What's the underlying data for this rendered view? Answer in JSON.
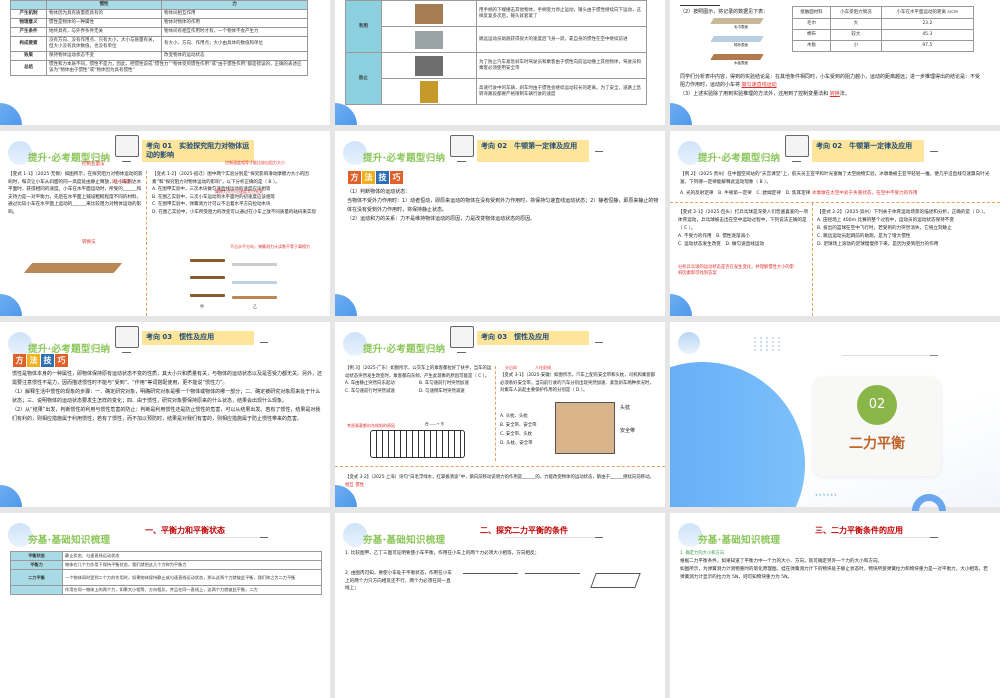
{
  "slides": [
    {
      "table": {
        "headers": [
          "惯性",
          "力"
        ],
        "rows": [
          [
            "产生机制",
            "物体因为具有质量而具有的",
            "物体间相互作用"
          ],
          [
            "物理意义",
            "惯性是物体的一种属性",
            "物体对物体的作用"
          ],
          [
            "产生条件",
            "始终具有，与外界条件无关",
            "物体间有相互作用时才有，一个物体不会产生力"
          ],
          [
            "构成要素",
            "没有方向、没有作用点、只有大小，大小与质量有关，但大小没有具体数值，也没有单位",
            "有大小、方向、作用点；大小由具体的数值和单位"
          ],
          [
            "效果",
            "保持物体运动状态不变",
            "改变物体的运动状态"
          ],
          [
            "总结",
            "惯性和力本质不同，惯性不是力，因此，把惯性说成“惯性力”“物体受到惯性作用”或“由于惯性作用”都是错误的，正确的表述应该为“物体由于惯性”或“物体因为具有惯性”",
            ""
          ]
        ]
      }
    },
    {
      "groups": [
        {
          "label": "利用",
          "items": [
            "用手柄的下端撞击其他物体，手柄受力停止运动，锤头由于惯性继续向下运动，这样反复多次后，锤头就套紧了",
            "跳远运动员助跑获得很大的速度后飞身一跃，靠自身的惯性在空中继续前进"
          ]
        },
        {
          "label": "防止",
          "items": [
            "为了防止汽车紧急刹车时驾驶员和乘客由于惯性向前运动撞上其他物体，驾驶员和乘客必须使用安全带",
            "高速行驶中的车辆，刹车时由于惯性会继续运动较长的距离。为了安全，道路上急转弯路段都要严格限制车辆行驶的速度"
          ]
        }
      ]
    },
    {
      "q2": "（2）按照图示，将记录的数据见下表：",
      "table_headers": [
        "接触面材料",
        "小车受阻力情况",
        "小车在水平面运动的距离 s/cm"
      ],
      "rows": [
        [
          "毛巾",
          "大",
          "23.2"
        ],
        [
          "棉布",
          "较大",
          "45.3"
        ],
        [
          "木板",
          "小",
          "97.5"
        ]
      ],
      "surfaces": [
        "毛巾表面",
        "棉布表面",
        "木板表面"
      ],
      "marks": [
        "甲",
        "乙",
        "丙"
      ],
      "conclusion": "同学们分析表中内容，得到的实验结论是：在其他条件相同时，小车受到的阻力越小，运动的距离越远；进一步推理得出的结论是：不受阻力作用时，运动的小车将",
      "answer1": "做匀速直线运动",
      "q3": "（3）上述实验除了用到实验推理的方法外，还用到了控制变量法和",
      "answer2": "转换",
      "q3_end": "法。"
    },
    {
      "header": "提升·必考题型归纳",
      "topic": "考向 01　实验探究阻力对物体运动的影响",
      "ann1": "控制变量法",
      "ann2": "控制速度相等才能比较出阻力大小",
      "left": "【变式 1-1】（2025·无锡）如图所示，在探究阻力对物体运动的影响时，每次让小车从斜面的同一高度处由静止释放，让小车到达水平面时，获得相同的速度。小车在水平面运动时，所受的______和支持力是一对平衡力，先后在水平面上铺设粗糙程度不同的材料，通过比较小车在水平面上运动的______来比较阻力对物体运动的影响。",
      "left_ann": [
        "同一高度",
        "重力",
        "距离",
        "转换法"
      ],
      "right": [
        "【变式 1-2】（2025·宿迁）图中两个实验分别是“探究影响滑动摩擦力大小的因素”和“探究阻力对物体运动的影响”，以下分析正确的是（ B ）。",
        "A. 在图甲实验中，三次木块做匀速直线运动的速度应该相等",
        "B. 在图乙实验中，三次小车运动到水平面时的初速度应该相等",
        "C. 在图甲实验中，弹簧测力计可以不沿着水平方向拉动木块",
        "D. 在图乙实验中，小车所受阻力的改变可以通过在小车上放不同质量的砝码来实现"
      ],
      "right_ann": [
        "摩擦力大小与速度大小无关",
        "分清实验目的是什么?",
        "不沿水平方向，弹簧测力计读数不等于摩擦力"
      ],
      "fig_labels": [
        "木板",
        "砝码",
        "木板",
        "砝码",
        "棉布",
        "毛巾",
        "棉布",
        "木板",
        "甲",
        "乙"
      ]
    },
    {
      "header": "提升·必考题型归纳",
      "topic": "考向 02　牛顿第一定律及应用",
      "method": [
        "方",
        "法",
        "技",
        "巧"
      ],
      "lines": [
        "（1）判断物体的运动状态：",
        "当物体不受外力作用时：1）动者恒动，即原来运动的物体在没有受到外力作用时，将保持匀速直线运动状态；2）静者恒静，即原来静止的物体在没有受到外力作用时，将保持静止状态。",
        "（2）运动和力的关系：力不是维持物体运动的原因，力是改变物体运动状态的原因。"
      ]
    },
    {
      "header": "提升·必考题型归纳",
      "topic": "考向 02　牛顿第一定律及应用",
      "ex": "【例 2】（2025·贵州）在中国空间站的“天宫课堂”上，航天员王亚平和叶光富做了太空抛物实验，冰墩墩被王亚平轻轻一推，便几乎沿直线匀速飘向叶光富。下列哪一定律能解释此运动现象（ B ）。",
      "ex_opts": "A. 光的反射定律　B. 牛顿第一定律　C. 欧姆定律　D. 焦耳定律",
      "ex_ann": "冰墩墩在太空中处于失重状态，在空中不受力的作用",
      "left": [
        "【变式 2-1】（2025·包头）打乒乓球是深受人们普遍喜爱的一项体育运动，乒乓球被击出在空中运动过程中，下列说法正确的是（ C ）。",
        "A. 不受力的作用　B. 惯性逐渐减小",
        "C. 运动状态发生改变　D. 做匀速直线运动"
      ],
      "left_ann": "分析乒乓球的运动状态是否在发生变化，并理解惯性大小的影响因素即可找到答案",
      "right": [
        "【变式 2-2】（2025·滨州）下列关于体育运动场景的描述和分析，正确的是（ D ）。",
        "A. 田径场上 400m 比赛的整个过程中，运动员的运动状态保持不变",
        "B. 投出的篮球在空中飞行时，若受到的力突然消失，它将立刻静止",
        "C. 跳远运动员起跳前的助跑，是为了增大惯性",
        "D. 足球场上滚动的足球慢慢停下来，是因为受到阻力的作用"
      ]
    },
    {
      "header": "提升·必考题型归纳",
      "topic": "考向 03　惯性及应用",
      "method": [
        "方",
        "法",
        "技",
        "巧"
      ],
      "lines": [
        "惯性是物体本身的一种属性，即物体保持原有运动状态不变的性质，其大小只和质量有关，与物体的运动状态以及是否受力都无关。另外，还需要注意惯性不是力，因而描述惯性时不能与“受到”、“作用”等词搭配使用，更不能说“惯性力”。",
        "（1）解释生活中惯性的现象的步骤：一、确定研究对象，明确研究对象是哪一个物体或物体的哪一部分；二、确定被研究对象原来处于什么状态；三、说明物体的运动状态要发生怎样的变化；四、由于惯性，研究对象要保持原来的什么状态，结果会出现什么现象。",
        "（2）从“结果”出发，判断惯性的利用与惯性危害的防止：判断是利用惯性还是防止惯性的危害，可以从结果出发。若有了惯性，结果是对我们有利的，则相应措施属于利用惯性；若有了惯性，而不加以预防时，结果是对我们有害的，则相应措施属于防止惯性带来的危害。"
      ]
    },
    {
      "header": "提升·必考题型归纳",
      "topic": "考向 03　惯性及应用",
      "ex": "【例 3】（2025·广东）如图所示，公交车上的乘客都拉好了扶手，当车的运动状态突然发生改变时，乘客都向东倾，产生此现象的原因可能是（ C ）。",
      "ex_opts": [
        "A. 车由静止突然向东起动",
        "B. 车匀速前行时突然加速",
        "C. 车匀速前行时突然减速",
        "D. 匀速倒车时突然减速"
      ],
      "ex_ann": "考虑乘客都向东倾斜的原因",
      "dir": "西 ——→ 东",
      "v31": [
        "【变式 3-1】（2025·安徽）如图所示，汽车上配有安全带和头枕，司机和乘客都必须系好安全带。当向前行驶的汽车分别出现突然加速、紧急刹车两种状况时，对乘车人员起主要保护作用的分别是（ D ）。",
        "A. 头枕、头枕",
        "B. 安全带、安全带",
        "C. 安全带、头枕",
        "D. 头枕、安全带"
      ],
      "v31_ann": [
        "头后仰",
        "人往前倾"
      ],
      "car_labels": [
        "头枕",
        "安全带"
      ],
      "v32": "【变式 3-2】（2025·上海）诗句“白毛浮绿水，红掌拨清波”中，鹅向前移动说明力的作用是______的，力能改变物体的运动状态，鹅由于______继续向前移动。",
      "v32_ans": [
        "相互",
        "惯性"
      ]
    },
    {
      "number": "02",
      "title": "二力平衡"
    },
    {
      "header": "夯基·基础知识梳理",
      "heading": "一、平衡力和平衡状态",
      "rows": [
        [
          "平衡状态",
          "静止状态、匀速直线运动状态"
        ],
        [
          "平衡力",
          "物体在几个力作用下保持平衡状态，我们就把这几个力称为平衡力"
        ],
        [
          "二力平衡",
          "一个物体同时受到二个力的作用时，如果物体保持静止或匀速直线运动状态，那么这两个力就彼此平衡，我们称之为二力平衡"
        ],
        [
          "",
          "作用在同一物体上的两个力，如果大小相等、方向相反，并且在同一直线上，这两个力就彼此平衡，二力"
        ]
      ]
    },
    {
      "header": "夯基·基础知识梳理",
      "heading": "二、探究二力平衡的条件",
      "p1": "1. 比较图甲、乙丁三图可证明要使小车平衡，作用在小车上的两个力必须大小相等，方向相反；",
      "p2": "2. 由图丙可知，要使小车处于平衡状态，作用在小车上的两个力只方向相反还不行，两个力必须在同一直线上；"
    },
    {
      "header": "夯基·基础知识梳理",
      "heading": "三、二力平衡条件的应用",
      "sub": "1. 确定力的大小和方向",
      "p1": "根据二力平衡条件，如果知道了平衡力中一个力的大小、方向，就可确定另外一个力的大小和方向。",
      "p2": "如图所示，为弹簧测力计测物重时的简化原理图。挂在弹簧测力计下的物块处于静止状态时，物块所受弹簧拉力和物块重力是一对平衡力，大小相等。若弹簧测力计显示的拉力为 5N，则可知物块重力为 5N。",
      "arrows": "››››››"
    }
  ],
  "colors": {
    "accent_green": "#8cc65a",
    "topic_bg": "#ffe59a",
    "red": "#c00000",
    "table_head": "#a9dbe6",
    "section_green": "#7cb342"
  }
}
